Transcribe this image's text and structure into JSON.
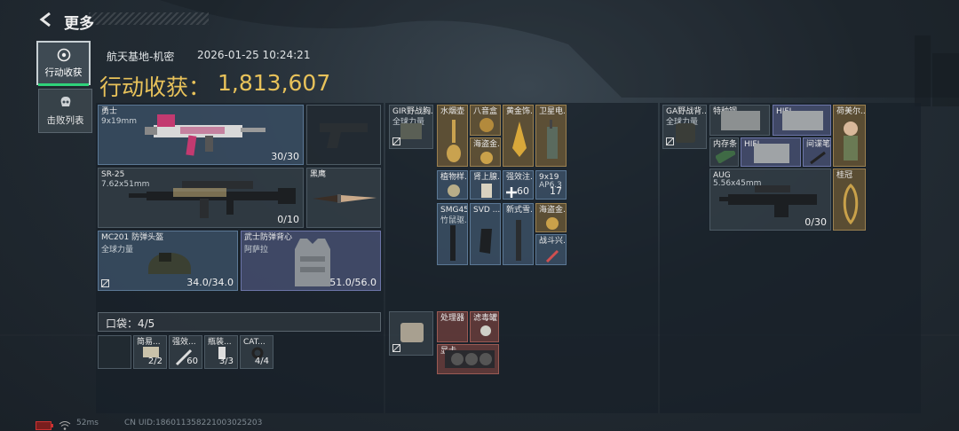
{
  "header": {
    "title": "更多"
  },
  "side_tabs": [
    {
      "label": "行动收获",
      "active": true
    },
    {
      "label": "击败列表",
      "active": false
    }
  ],
  "info": {
    "map": "航天基地-机密",
    "timestamp": "2026-01-25 10:24:21"
  },
  "harvest": {
    "label": "行动收获：",
    "value": "1,813,607"
  },
  "equipment": {
    "primary": {
      "name": "勇士",
      "caliber": "9x19mm",
      "ammo": "30/30"
    },
    "sidearm": {
      "name": ""
    },
    "secondary": {
      "name": "SR-25",
      "caliber": "7.62x51mm",
      "ammo": "0/10"
    },
    "melee": {
      "name": "黑鹰"
    },
    "helmet": {
      "name": "MC201 防弹头盔",
      "sub": "全球力量",
      "durability": "34.0/34.0"
    },
    "armor": {
      "name": "武士防弹背心",
      "sub": "阿萨拉",
      "durability": "51.0/56.0"
    }
  },
  "pocket": {
    "label": "口袋：4/5",
    "items": [
      {
        "name": "",
        "count": ""
      },
      {
        "name": "简易...",
        "count": "2/2"
      },
      {
        "name": "强效...",
        "count": "60"
      },
      {
        "name": "瓶装...",
        "count": "3/3"
      },
      {
        "name": "CAT...",
        "count": "4/4"
      }
    ]
  },
  "chest_rig": {
    "rig_name": "GIR野战胸...",
    "rig_sub": "全球力量",
    "items": [
      {
        "name": "水烟壶"
      },
      {
        "name": "八音盒"
      },
      {
        "name": "黄金饰..."
      },
      {
        "name": "卫星电..."
      },
      {
        "name": "海盗金..."
      },
      {
        "name": "植物样..."
      },
      {
        "name": "肾上腺..."
      },
      {
        "name": "强效注..."
      },
      {
        "name": "9x19",
        "sub": "AP6.3",
        "count": "17"
      },
      {
        "name": "SMG45",
        "sub": "竹鼠驱..."
      },
      {
        "name": "SVD ..."
      },
      {
        "name": "新式雪..."
      },
      {
        "name": "海盗金..."
      },
      {
        "name": "战斗兴..."
      }
    ],
    "inj_count": "60"
  },
  "pouch": {
    "items": [
      {
        "name": "处理器"
      },
      {
        "name": "滤毒罐"
      },
      {
        "name": "显卡"
      }
    ]
  },
  "backpack": {
    "pack_name": "GA野战背...",
    "pack_sub": "全球力量",
    "items": [
      {
        "name": "特种钢"
      },
      {
        "name": "HIFI..."
      },
      {
        "name": "荷美尔..."
      },
      {
        "name": "内存条"
      },
      {
        "name": "HIFI..."
      },
      {
        "name": "间谍笔"
      },
      {
        "name": "AUG",
        "sub": "5.56x45mm",
        "count": "0/30"
      },
      {
        "name": "桂冠"
      }
    ]
  },
  "footer": {
    "ping": "52ms",
    "uid": "CN UID:1860113582210030252​03"
  },
  "colors": {
    "gold": "#e8c25a",
    "purple": "#5860 8c",
    "active_green": "#2fd27a"
  }
}
